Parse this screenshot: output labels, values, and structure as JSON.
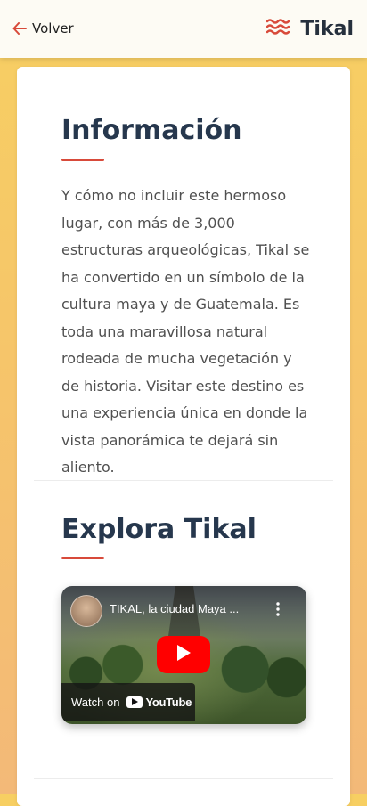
{
  "header": {
    "back_label": "Volver",
    "brand": "Tikal",
    "accent_color": "#d84a3a"
  },
  "sections": {
    "info": {
      "title": "Información",
      "text": "Y cómo no incluir este hermoso lugar, con más de 3,000 estructuras arqueológicas, Tikal se ha convertido en un símbolo de la cultura maya y de Guatemala. Es toda una maravillosa natural rodeada de mucha vegetación y de historia. Visitar este destino es una experiencia única en donde la vista panorámica te dejará sin aliento."
    },
    "explore": {
      "title": "Explora Tikal",
      "video": {
        "title": "TIKAL, la ciudad Maya ...",
        "watch_on": "Watch on",
        "platform": "YouTube"
      }
    }
  }
}
